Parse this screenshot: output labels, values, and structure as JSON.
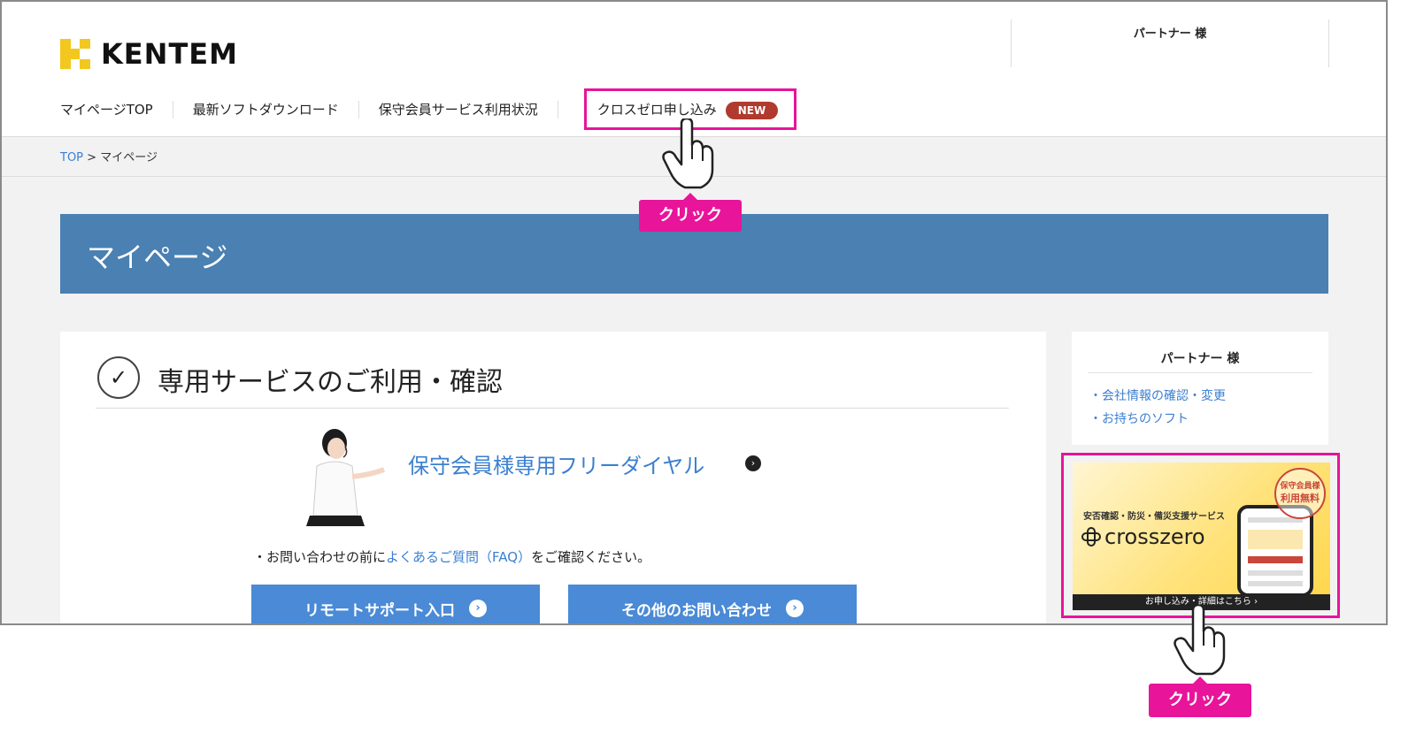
{
  "header": {
    "logo_text": "KENTEM",
    "partner_label": "パートナー 様"
  },
  "nav": {
    "items": [
      {
        "label": "マイページTOP"
      },
      {
        "label": "最新ソフトダウンロード"
      },
      {
        "label": "保守会員サービス利用状況"
      },
      {
        "label": "クロスゼロ申し込み",
        "badge": "NEW"
      }
    ]
  },
  "breadcrumb": {
    "top": "TOP",
    "separator": ">",
    "current": "マイページ"
  },
  "banner": {
    "title": "マイページ"
  },
  "main": {
    "title": "専用サービスのご利用・確認",
    "free_dial": "保守会員様専用フリーダイヤル",
    "faq_prefix": "・お問い合わせの前に",
    "faq_link": "よくあるご質問（FAQ）",
    "faq_suffix": "をご確認ください。",
    "buttons": [
      {
        "label": "リモートサポート入口"
      },
      {
        "label": "その他のお問い合わせ"
      }
    ]
  },
  "sidebar": {
    "partner_label": "パートナー 様",
    "links": [
      {
        "label": "・会社情報の確認・変更"
      },
      {
        "label": "・お持ちのソフト"
      }
    ]
  },
  "crosszero_banner": {
    "subtitle": "安否確認・防災・備災支援サービス",
    "logo": "crosszero",
    "stamp_line1": "保守会員様",
    "stamp_line2": "利用無料",
    "footer": "お申し込み・詳細はこちら ›"
  },
  "annotations": {
    "click_label_1": "クリック",
    "click_label_2": "クリック"
  },
  "colors": {
    "highlight": "#e8149a",
    "banner_blue": "#4a80b2",
    "button_blue": "#4a8ad6",
    "link_blue": "#3b7fd0",
    "new_badge": "#b03a2e"
  }
}
